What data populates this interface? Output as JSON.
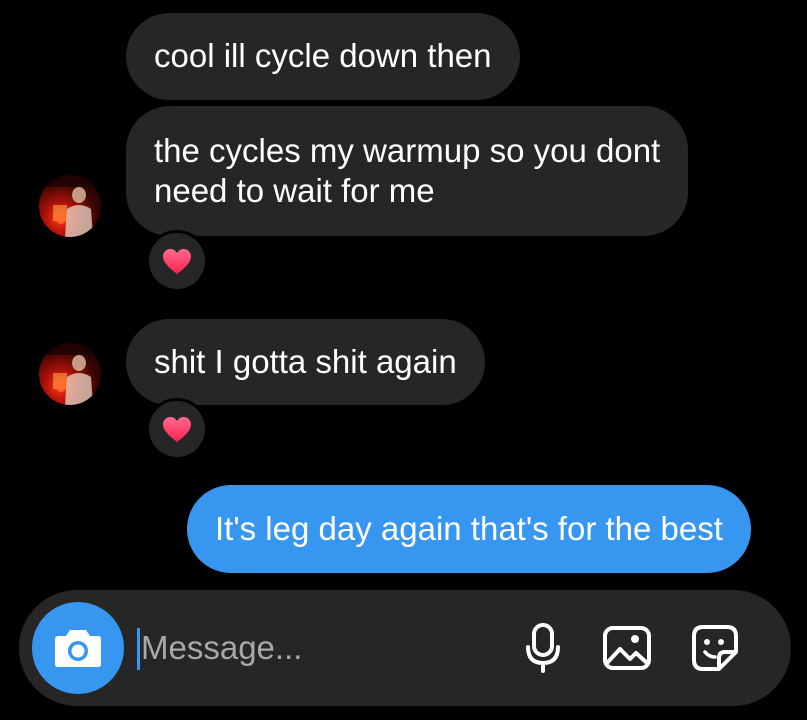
{
  "thread": {
    "messages": [
      {
        "sender": "them",
        "text": "cool ill cycle down then"
      },
      {
        "sender": "them",
        "line1": "the cycles my warmup so you dont",
        "line2": "need to wait for me",
        "reaction": "heart"
      },
      {
        "sender": "them",
        "text": "shit I gotta shit again",
        "reaction": "heart"
      },
      {
        "sender": "me",
        "text": "It's leg day again that's for the best"
      }
    ]
  },
  "composer": {
    "placeholder": "Message...",
    "icons": [
      "camera-icon",
      "microphone-icon",
      "gallery-icon",
      "sticker-icon"
    ]
  },
  "colors": {
    "background": "#000000",
    "incoming_bubble": "#262626",
    "outgoing_bubble": "#3797f0",
    "reaction_heart": "#ff2f6a",
    "text": "#ffffff",
    "placeholder": "#a8a8a8"
  }
}
